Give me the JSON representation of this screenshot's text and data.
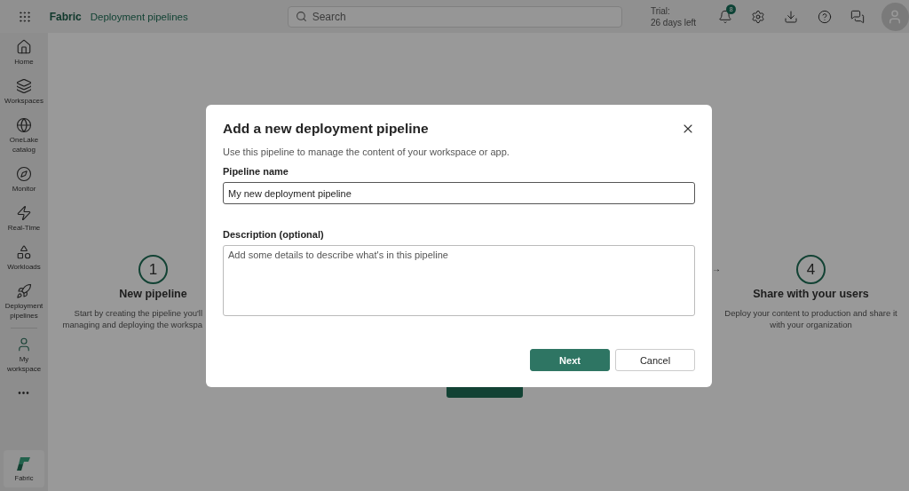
{
  "topbar": {
    "brand": "Fabric",
    "section": "Deployment pipelines",
    "search": {
      "placeholder": "Search"
    },
    "trial": [
      "Trial:",
      "26 days left"
    ],
    "notifications": {
      "count": "8"
    }
  },
  "sidebar": {
    "items": [
      {
        "label": "Home"
      },
      {
        "label": "Workspaces"
      },
      {
        "label": "OneLake catalog"
      },
      {
        "label": "Monitor"
      },
      {
        "label": "Real-Time"
      },
      {
        "label": "Workloads"
      },
      {
        "label": "Deployment pipelines"
      }
    ],
    "workspace": {
      "label": "My workspace"
    },
    "more": "•••",
    "footer": {
      "label": "Fabric"
    }
  },
  "steps": [
    {
      "number": "1",
      "title": "New pipeline",
      "lines": [
        "Start by creating the pipeline you'll",
        "managing and deploying the workspa"
      ]
    },
    {
      "number": "4",
      "title": "Share with your users",
      "lines": [
        "Deploy your content to production and share it",
        "with your organization"
      ],
      "arrow": "→"
    }
  ],
  "dialog": {
    "title": "Add a new deployment pipeline",
    "subtitle": "Use this pipeline to manage the content of your workspace or app.",
    "name_label": "Pipeline name",
    "name_value": "My new deployment pipeline",
    "description_label": "Description (optional)",
    "description_placeholder": "Add some details to describe what's in this pipeline",
    "buttons": [
      {
        "label": "Next",
        "kind": "primary"
      },
      {
        "label": "Cancel",
        "kind": "secondary"
      }
    ]
  }
}
